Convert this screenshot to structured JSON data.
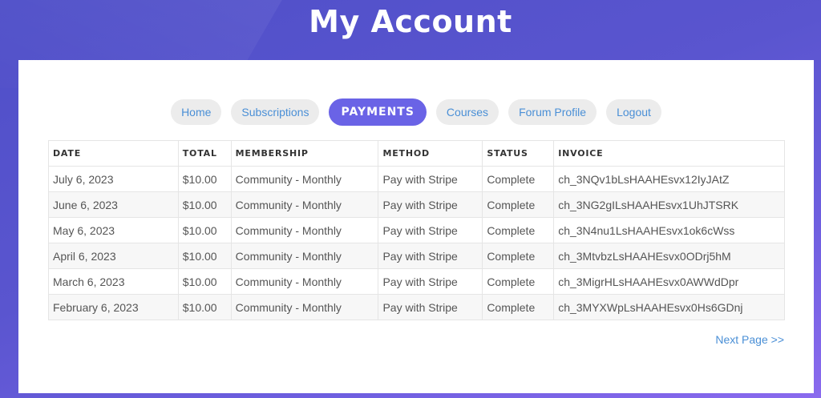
{
  "page": {
    "title": "My Account"
  },
  "nav": {
    "items": [
      {
        "label": "Home"
      },
      {
        "label": "Subscriptions"
      },
      {
        "label": "PAYMENTS"
      },
      {
        "label": "Courses"
      },
      {
        "label": "Forum Profile"
      },
      {
        "label": "Logout"
      }
    ],
    "active": "PAYMENTS"
  },
  "table": {
    "columns": [
      "DATE",
      "TOTAL",
      "MEMBERSHIP",
      "METHOD",
      "STATUS",
      "INVOICE"
    ],
    "rows": [
      [
        "July 6, 2023",
        "$10.00",
        "Community - Monthly",
        "Pay with Stripe",
        "Complete",
        "ch_3NQv1bLsHAAHEsvx12IyJAtZ"
      ],
      [
        "June 6, 2023",
        "$10.00",
        "Community - Monthly",
        "Pay with Stripe",
        "Complete",
        "ch_3NG2gILsHAAHEsvx1UhJTSRK"
      ],
      [
        "May 6, 2023",
        "$10.00",
        "Community - Monthly",
        "Pay with Stripe",
        "Complete",
        "ch_3N4nu1LsHAAHEsvx1ok6cWss"
      ],
      [
        "April 6, 2023",
        "$10.00",
        "Community - Monthly",
        "Pay with Stripe",
        "Complete",
        "ch_3MtvbzLsHAAHEsvx0ODrj5hM"
      ],
      [
        "March 6, 2023",
        "$10.00",
        "Community - Monthly",
        "Pay with Stripe",
        "Complete",
        "ch_3MigrHLsHAAHEsvx0AWWdDpr"
      ],
      [
        "February 6, 2023",
        "$10.00",
        "Community - Monthly",
        "Pay with Stripe",
        "Complete",
        "ch_3MYXWpLsHAAHEsvx0Hs6GDnj"
      ]
    ]
  },
  "pagination": {
    "next_label": "Next Page >>"
  },
  "colors": {
    "background_start": "#4f4fc8",
    "background_end": "#8a6aee",
    "accent": "#6a63e6",
    "link": "#4a8fd6",
    "pill_background": "#ececec"
  }
}
